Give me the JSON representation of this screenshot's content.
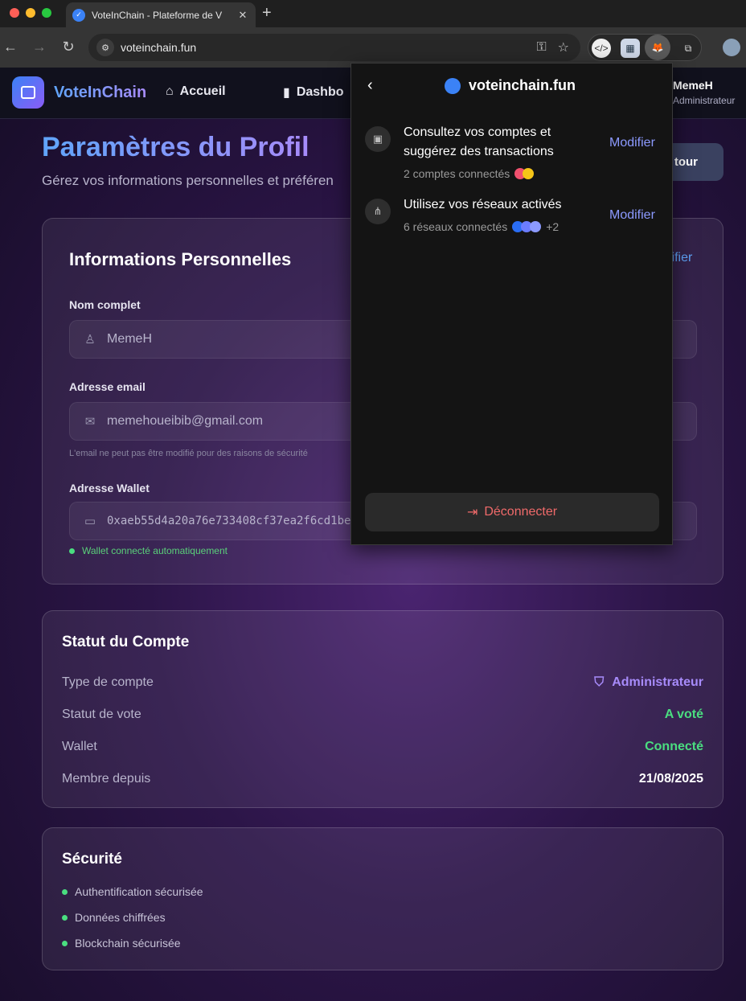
{
  "browser": {
    "tab_title": "VoteInChain - Plateforme de V",
    "tab_close": "✕",
    "new_tab": "+",
    "url": "voteinchain.fun",
    "colors": {
      "close": "#ff5f57",
      "minimize": "#febc2e",
      "maximize": "#28c840"
    }
  },
  "app": {
    "logo_text": "VoteInChain",
    "nav": [
      {
        "label": "Accueil",
        "icon": "home-icon"
      },
      {
        "label": "Dashbo",
        "icon": "bar-chart-icon"
      }
    ],
    "user": {
      "name": "MemeH",
      "role": "Administrateur"
    }
  },
  "profile": {
    "title": "Paramètres du Profil",
    "subtitle": "Gérez vos informations personnelles et préféren",
    "back_label": "tour"
  },
  "personal": {
    "title": "Informations Personnelles",
    "edit_label": "lifier",
    "name_label": "Nom complet",
    "name_value": "MemeH",
    "email_label": "Adresse email",
    "email_value": "memehoueibib@gmail.com",
    "email_hint": "L'email ne peut pas être modifié pour des raisons de sécurité",
    "wallet_label": "Adresse Wallet",
    "wallet_value": "0xaeb55d4a20a76e733408cf37ea2f6cd1be",
    "wallet_status": "Wallet connecté automatiquement"
  },
  "account": {
    "title": "Statut du Compte",
    "rows": [
      {
        "key": "Type de compte",
        "value": "Administrateur",
        "color": "#a78bfa"
      },
      {
        "key": "Statut de vote",
        "value": "A voté",
        "color": "#4ade80"
      },
      {
        "key": "Wallet",
        "value": "Connecté",
        "color": "#4ade80"
      },
      {
        "key": "Membre depuis",
        "value": "21/08/2025",
        "color": "#ffffff"
      }
    ]
  },
  "security": {
    "title": "Sécurité",
    "items": [
      "Authentification sécurisée",
      "Données chiffrées",
      "Blockchain sécurisée"
    ]
  },
  "popup": {
    "site": "voteinchain.fun",
    "perm_accounts_text": "Consultez vos comptes et suggérez des transactions",
    "perm_accounts_meta": "2 comptes connectés",
    "perm_networks_text": "Utilisez vos réseaux activés",
    "perm_networks_meta": "6 réseaux connectés",
    "perm_networks_more": "+2",
    "modify_label": "Modifier",
    "disconnect_label": "Déconnecter"
  }
}
